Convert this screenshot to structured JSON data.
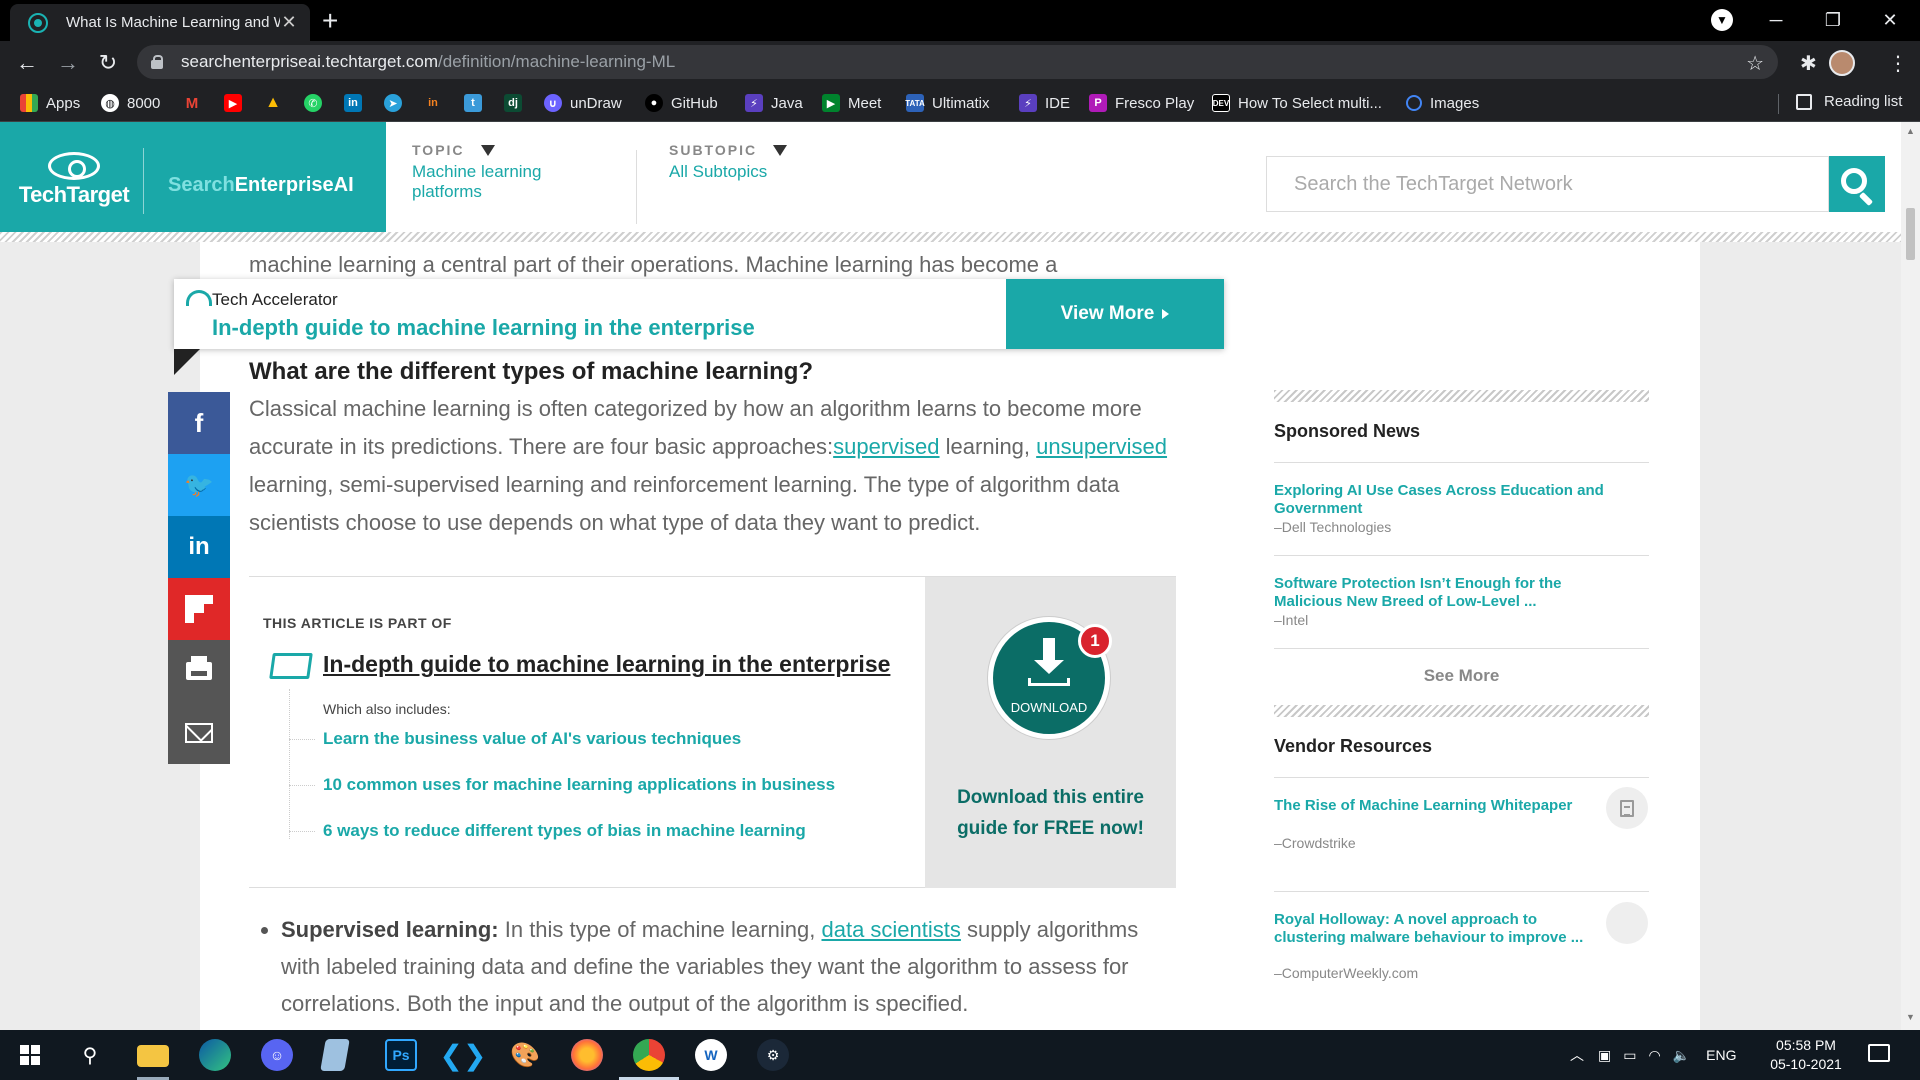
{
  "browser": {
    "tab_title": "What Is Machine Learning and W",
    "url_host": "searchenterpriseai.techtarget.com",
    "url_path": "/definition/machine-learning-ML",
    "bookmarks": [
      "Apps",
      "8000",
      "unDraw",
      "GitHub",
      "Java",
      "Meet",
      "Ultimatix",
      "IDE",
      "Fresco Play",
      "How To Select multi...",
      "Images"
    ],
    "reading_list": "Reading list",
    "download_badge": "1"
  },
  "site": {
    "logo_text": "TechTarget",
    "site_name_1": "Search",
    "site_name_2": "EnterpriseAI",
    "topic_label": "TOPIC",
    "topic_value": "Machine learning platforms",
    "subtopic_label": "SUBTOPIC",
    "subtopic_value": "All Subtopics",
    "search_placeholder": "Search the TechTarget Network"
  },
  "tech_accelerator": {
    "label": "Tech Accelerator",
    "title": "In-depth guide to machine learning in the enterprise",
    "button": "View More"
  },
  "article": {
    "cut_text": "machine learning a central part of their operations. Machine learning has become a",
    "heading": "What are the different types of machine learning?",
    "p1_a": "Classical machine learning is often categorized by how an algorithm learns to become more accurate in its predictions. There are four basic approaches:",
    "p1_link1": "supervised",
    "p1_b": " learning, ",
    "p1_link2": "unsupervised",
    "p1_c": " learning, semi-supervised learning and reinforcement learning. The type of algorithm data scientists choose to use depends on what type of data they want to predict.",
    "part_of_label": "THIS ARTICLE IS PART OF",
    "part_of_title": "In-depth guide to machine learning in the enterprise",
    "also_includes": "Which also includes:",
    "part_links": [
      "Learn the business value of AI's various techniques",
      "10 common uses for machine learning applications in business",
      "6 ways to reduce different types of bias in machine learning"
    ],
    "download_label": "DOWNLOAD",
    "download_badge": "1",
    "download_cta": "Download this entire guide for FREE now!",
    "bullet_bold": "Supervised learning:",
    "bullet_a": " In this type of machine learning, ",
    "bullet_link": "data scientists",
    "bullet_b": " supply algorithms with labeled training data and define the variables they want the algorithm to assess for correlations. Both the input and the output of the algorithm is specified."
  },
  "rail": {
    "sponsored_heading": "Sponsored News",
    "sponsored": [
      {
        "title": "Exploring AI Use Cases Across Education and Government",
        "source": "–Dell Technologies"
      },
      {
        "title": "Software Protection Isn’t Enough for the Malicious New Breed of Low-Level ...",
        "source": "–Intel"
      }
    ],
    "see_more": "See More",
    "vendor_heading": "Vendor Resources",
    "vendor": [
      {
        "title": "The Rise of Machine Learning Whitepaper",
        "source": "–Crowdstrike"
      },
      {
        "title": "Royal Holloway: A novel approach to clustering malware behaviour to improve ...",
        "source": "–ComputerWeekly.com"
      }
    ]
  },
  "taskbar": {
    "lang": "ENG",
    "time": "05:58 PM",
    "date": "05-10-2021"
  },
  "colors": {
    "accent": "#1aa8a8",
    "dark_teal": "#0b6d66",
    "facebook": "#3b5998",
    "twitter": "#1da1f2",
    "linkedin": "#0077b5",
    "flipboard": "#e02828"
  }
}
